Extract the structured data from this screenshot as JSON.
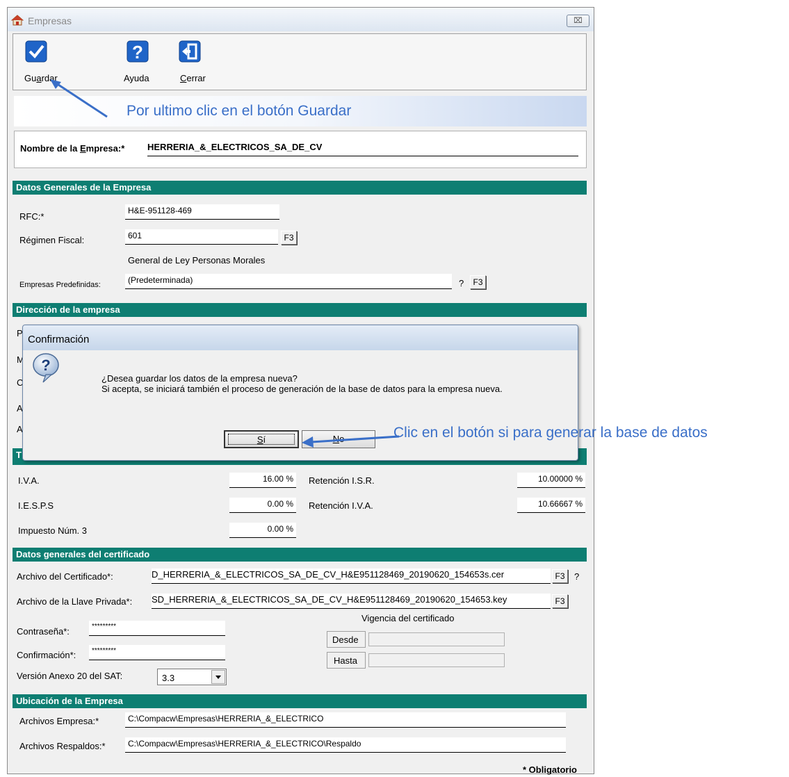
{
  "window": {
    "title": "Empresas",
    "close_label": "⌧"
  },
  "toolbar": {
    "save_pre": "Gu",
    "save_key": "a",
    "save_post": "rdar",
    "help_label": "Ayuda",
    "close_key": "C",
    "close_post": "errar"
  },
  "annotations": {
    "save_hint": "Por ultimo clic en el botón Guardar",
    "yes_hint": "Clic en el botón si para generar la base de datos"
  },
  "company": {
    "name_label_pre": "Nombre de la ",
    "name_label_key": "E",
    "name_label_post": "mpresa:*",
    "name_value": "HERRERIA_&_ELECTRICOS_SA_DE_CV"
  },
  "general": {
    "section_title": "Datos Generales de la Empresa",
    "rfc_label": "RFC:*",
    "rfc_value": "H&E-951128-469",
    "regimen_label": "Régimen Fiscal:",
    "regimen_value": "601",
    "regimen_desc": "General de Ley Personas Morales",
    "predef_label": "Empresas Predefinidas:",
    "predef_value": "(Predeterminada)",
    "question": "?",
    "f3": "F3"
  },
  "address": {
    "section_title": "Dirección de la empresa",
    "hidden_initials": [
      "P",
      "M",
      "C",
      "A",
      "A"
    ],
    "next_section_initial": "T"
  },
  "dialog": {
    "title": "Confirmación",
    "message_line1": "¿Desea guardar los datos de la empresa nueva?",
    "message_line2": "Si acepta, se iniciará también el proceso de generación de la base de datos para la empresa nueva.",
    "yes_key": "S",
    "yes_post": "í",
    "no_key": "N",
    "no_post": "o"
  },
  "taxes": {
    "iva_label": "I.V.A.",
    "iva_value": "16.00 %",
    "iesps_label": "I.E.S.P.S",
    "iesps_value": "0.00 %",
    "imp3_label": "Impuesto Núm. 3",
    "imp3_value": "0.00 %",
    "ret_isr_label": "Retención I.S.R.",
    "ret_isr_value": "10.00000 %",
    "ret_iva_label": "Retención I.V.A.",
    "ret_iva_value": "10.66667 %"
  },
  "certificate": {
    "section_title": "Datos generales del certificado",
    "cert_label": "Archivo del Certificado*:",
    "cert_value": "D_HERRERIA_&_ELECTRICOS_SA_DE_CV_H&E951128469_20190620_154653s.cer",
    "key_label": "Archivo de la Llave Privada*:",
    "key_value": "SD_HERRERIA_&_ELECTRICOS_SA_DE_CV_H&E951128469_20190620_154653.key",
    "password_label": "Contraseña*:",
    "password_value": "*********",
    "confirm_label": "Confirmación*:",
    "confirm_value": "*********",
    "anexo_label": "Versión Anexo 20 del SAT:",
    "anexo_value": "3.3",
    "validity_title": "Vigencia del certificado",
    "from_label": "Desde",
    "to_label": "Hasta"
  },
  "location": {
    "section_title": "Ubicación de la Empresa",
    "files_label": "Archivos Empresa:*",
    "files_value": "C:\\Compacw\\Empresas\\HERRERIA_&_ELECTRICO",
    "backups_label": "Archivos Respaldos:*",
    "backups_value": "C:\\Compacw\\Empresas\\HERRERIA_&_ELECTRICO\\Respaldo"
  },
  "footer": {
    "required_note": "* Obligatorio"
  },
  "colors": {
    "section_bg": "#0e7e72",
    "annotation": "#3a6fc8",
    "check_icon": "#1f64c8"
  }
}
